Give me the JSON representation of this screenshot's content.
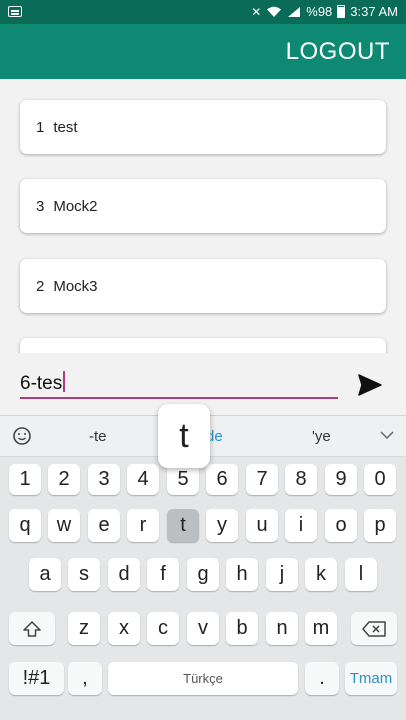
{
  "status_bar": {
    "battery": "%98",
    "time": "3:37 AM"
  },
  "app_bar": {
    "logout_label": "LOGOUT"
  },
  "items": [
    {
      "num": "1",
      "name": "test"
    },
    {
      "num": "3",
      "name": "Mock2"
    },
    {
      "num": "2",
      "name": "Mock3"
    }
  ],
  "composer": {
    "value": "6-tes"
  },
  "keyboard": {
    "suggestions": [
      "-te",
      "de",
      "'ye"
    ],
    "popup_key": "t",
    "row_numbers": [
      "1",
      "2",
      "3",
      "4",
      "5",
      "6",
      "7",
      "8",
      "9",
      "0"
    ],
    "row_top": [
      "q",
      "w",
      "e",
      "r",
      "t",
      "y",
      "u",
      "i",
      "o",
      "p"
    ],
    "row_middle": [
      "a",
      "s",
      "d",
      "f",
      "g",
      "h",
      "j",
      "k",
      "l"
    ],
    "row_bottom": [
      "z",
      "x",
      "c",
      "v",
      "b",
      "n",
      "m"
    ],
    "symbols_label": "!#1",
    "comma_label": ",",
    "space_label": "Türkçe",
    "period_label": ".",
    "done_label": "Tmam"
  },
  "colors": {
    "status_bar": "#0a6b58",
    "app_bar": "#0e8a74",
    "accent": "#b03a7a",
    "done_key": "#2b93c8"
  }
}
